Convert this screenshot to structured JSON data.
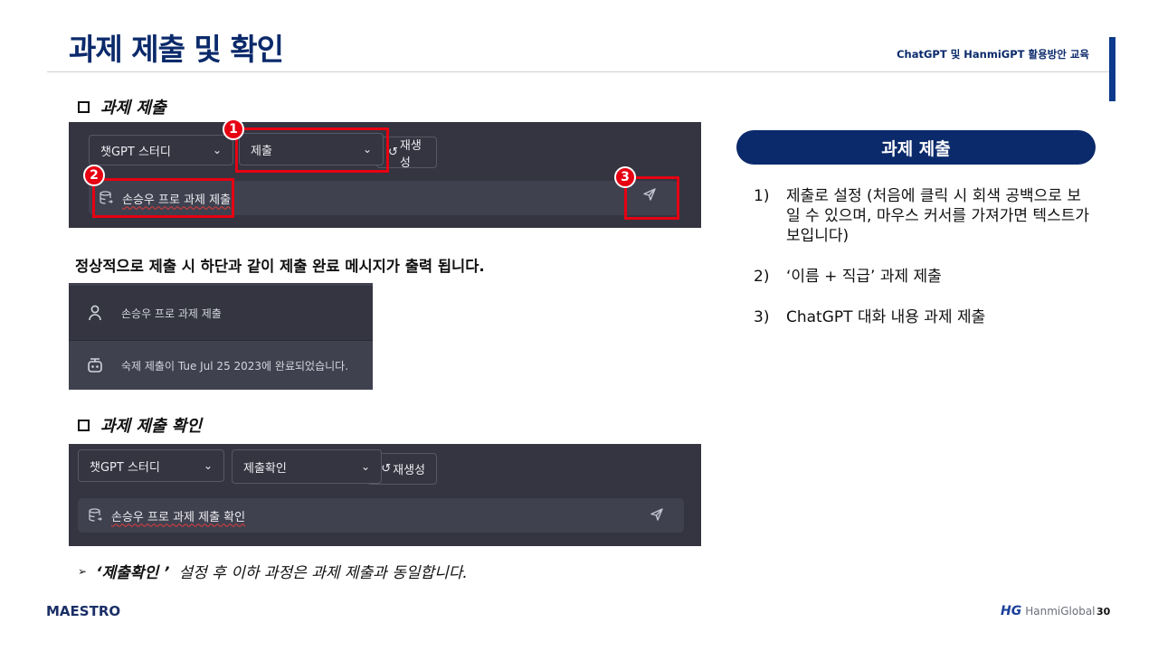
{
  "header": {
    "title": "과제 제출 및 확인",
    "subtitle": "ChatGPT 및 HanmiGPT 활용방안 교육"
  },
  "section1": {
    "heading": "과제 제출",
    "screenshot": {
      "model_select": "챗GPT 스터디",
      "mode_select": "제출",
      "regen_button": "재생성",
      "input_text": "손승우 프로 과제 제출",
      "markers": [
        "1",
        "2",
        "3"
      ]
    }
  },
  "notice": "정상적으로 제출 시 하단과 같이 제출 완료 메시지가 출력 됩니다.",
  "chat": {
    "user_message": "손승우 프로 과제 제출",
    "bot_message": "숙제 제출이 Tue Jul 25 2023에 완료되었습니다."
  },
  "section2": {
    "heading": "과제 제출 확인",
    "screenshot": {
      "model_select": "챗GPT 스터디",
      "mode_select": "제출확인",
      "regen_button": "재생성",
      "input_text": "손승우 프로 과제 제출 확인"
    }
  },
  "bottom_note": {
    "quoted": "‘제출확인 ’",
    "rest": "설정 후 이하 과정은 과제 제출과 동일합니다."
  },
  "side_panel": {
    "title": "과제 제출",
    "steps": [
      {
        "num": "1)",
        "text": "제출로 설정 (처음에 클릭 시 회색 공백으로 보일 수 있으며, 마우스 커서를 가져가면 텍스트가 보입니다)"
      },
      {
        "num": "2)",
        "text": "‘이름 + 직급’ 과제 제출"
      },
      {
        "num": "3)",
        "text": "ChatGPT 대화 내용 과제 제출"
      }
    ]
  },
  "footer": {
    "logo_left": "MAESTRO",
    "logo_right_mark": "HG",
    "logo_right_name": "HanmiGlobal",
    "page_number": "30"
  },
  "colors": {
    "title_navy": "#0b2a6b",
    "accent_red": "#e60012",
    "dark_panel": "#343540",
    "input_bg": "#40414f"
  }
}
